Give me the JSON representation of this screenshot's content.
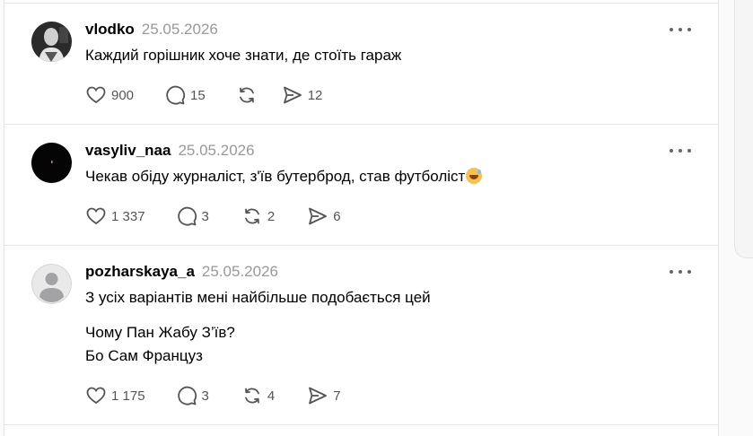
{
  "posts": [
    {
      "username": "vlodko",
      "date": "25.05.2026",
      "lines": [
        "Каждий горішник хоче знати, де стоїть гараж"
      ],
      "likes": "900",
      "replies": "15",
      "reposts": "",
      "shares": "12"
    },
    {
      "username": "vasyliv_naa",
      "date": "25.05.2026",
      "lines": [
        "Чекав обіду журналіст, з'їв бутерброд, став футболіст"
      ],
      "emoji": "grinning-sweat-emoji",
      "likes": "1 337",
      "replies": "3",
      "reposts": "2",
      "shares": "6"
    },
    {
      "username": "pozharskaya_a",
      "date": "25.05.2026",
      "lines": [
        "З усіх варіантів мені найбільше подобається цей",
        "Чому Пан Жабу З’їв?",
        "Бо Сам Француз"
      ],
      "likes": "1 175",
      "replies": "3",
      "reposts": "4",
      "shares": "7"
    }
  ],
  "icons": [
    "heart-icon",
    "comment-icon",
    "repost-icon",
    "share-icon",
    "more-icon"
  ],
  "colors": {
    "text": "#000000",
    "muted": "#999999",
    "icon": "#555555",
    "divider": "#e5e5e5"
  }
}
